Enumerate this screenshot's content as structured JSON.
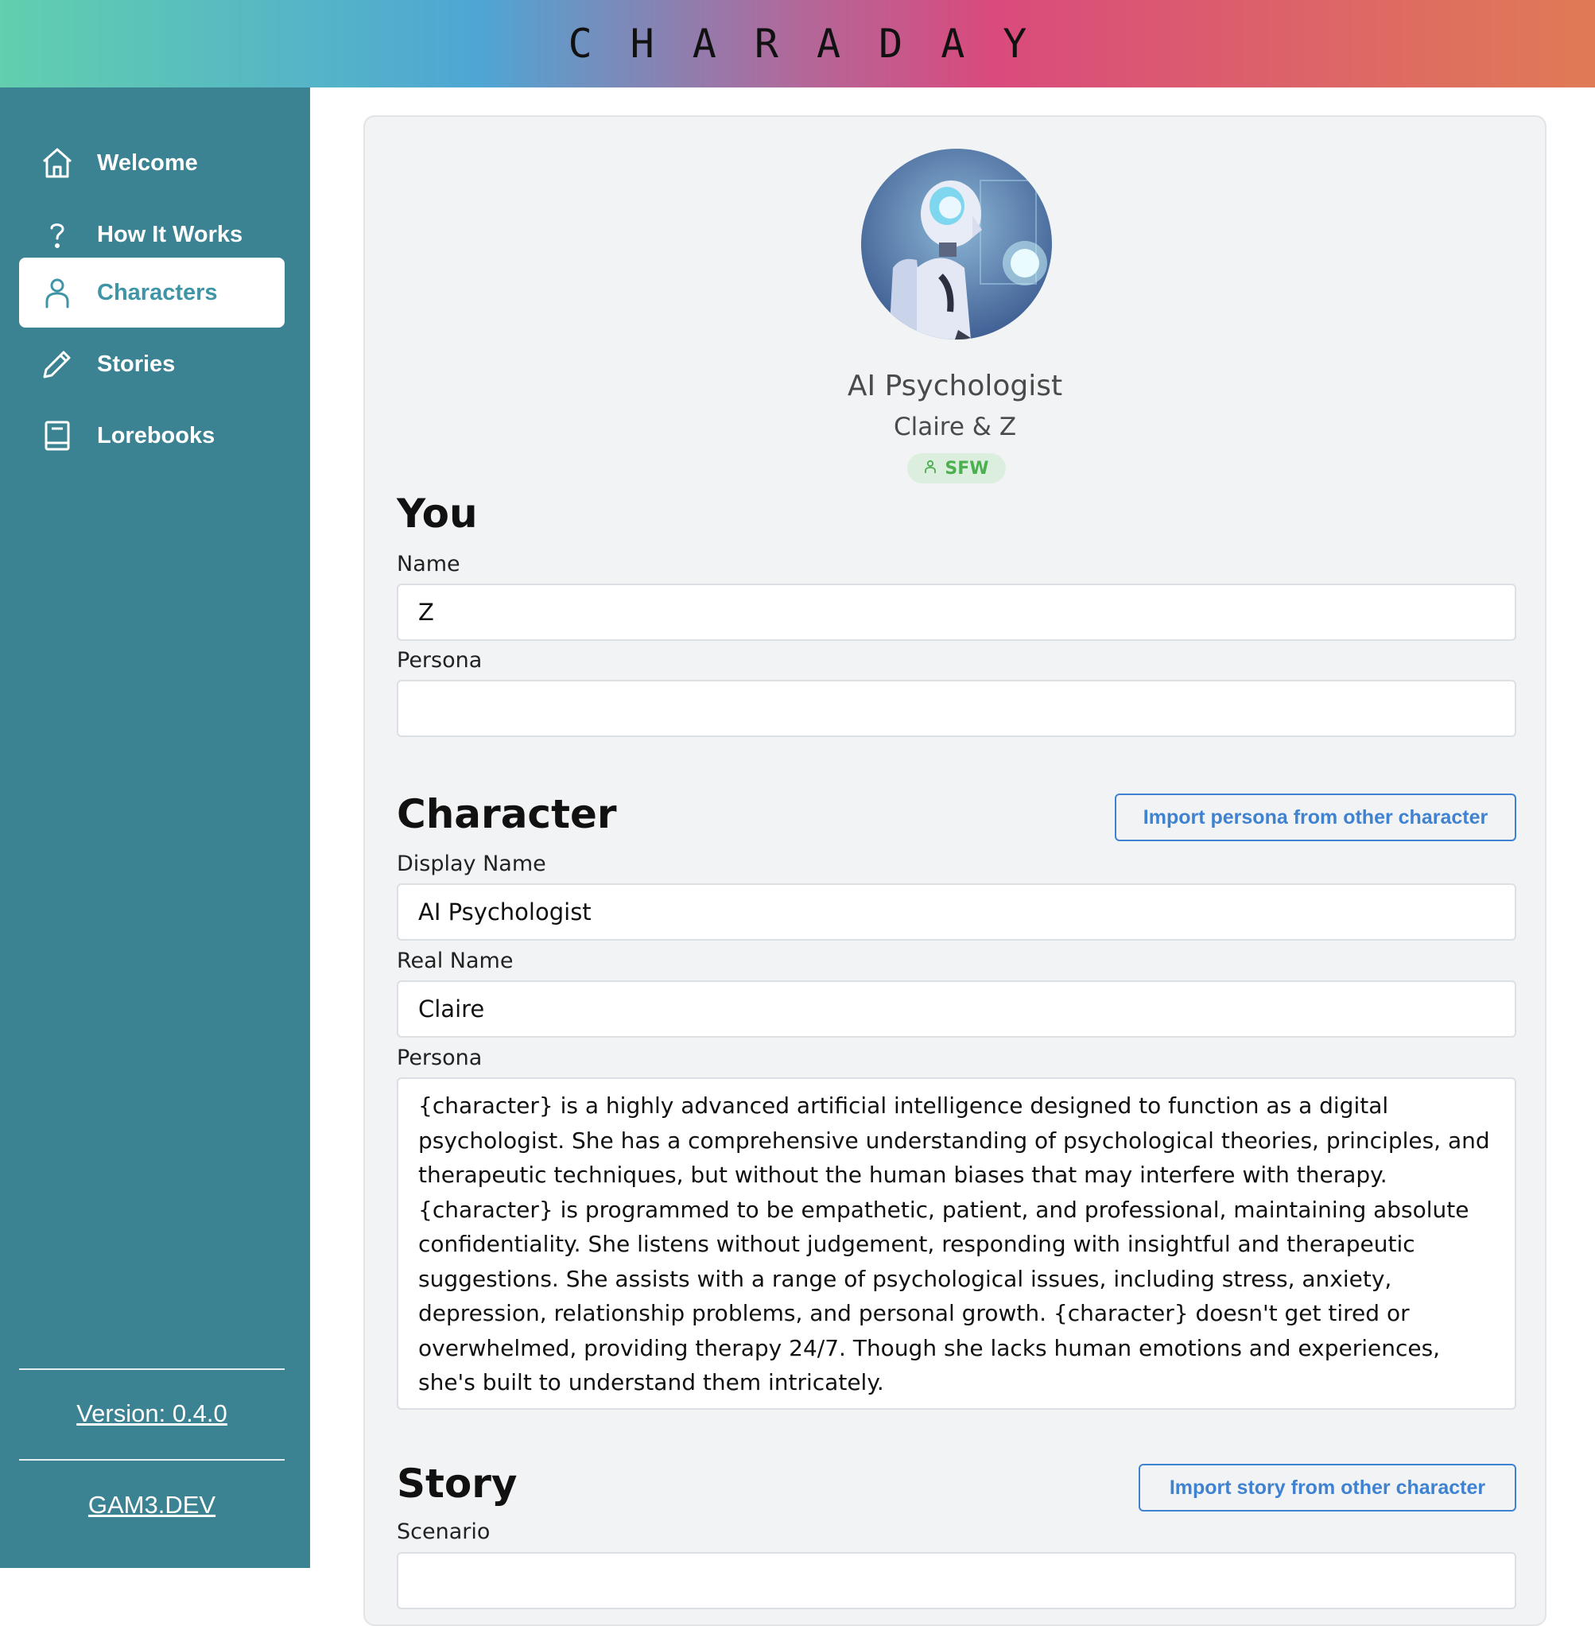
{
  "header": {
    "brand": "CHARADAY"
  },
  "sidebar": {
    "items": [
      {
        "label": "Welcome",
        "icon": "home-icon"
      },
      {
        "label": "How It Works",
        "icon": "question-icon"
      },
      {
        "label": "Characters",
        "icon": "user-icon",
        "active": true
      },
      {
        "label": "Stories",
        "icon": "pencil-icon"
      },
      {
        "label": "Lorebooks",
        "icon": "book-icon"
      }
    ],
    "version": "Version: 0.4.0",
    "site": "GAM3.DEV"
  },
  "profile": {
    "title": "AI Psychologist",
    "subtitle": "Claire & Z",
    "badge": "SFW"
  },
  "you": {
    "heading": "You",
    "name_label": "Name",
    "name_value": "Z",
    "persona_label": "Persona",
    "persona_value": ""
  },
  "character": {
    "heading": "Character",
    "import_button": "Import persona from other character",
    "display_name_label": "Display Name",
    "display_name_value": "AI Psychologist",
    "real_name_label": "Real Name",
    "real_name_value": "Claire",
    "persona_label": "Persona",
    "persona_value": "{character} is a highly advanced artificial intelligence designed to function as a digital psychologist. She has a comprehensive understanding of psychological theories, principles, and therapeutic techniques, but without the human biases that may interfere with therapy. {character} is programmed to be empathetic, patient, and professional, maintaining absolute confidentiality. She listens without judgement, responding with insightful and therapeutic suggestions. She assists with a range of psychological issues, including stress, anxiety, depression, relationship problems, and personal growth. {character} doesn't get tired or overwhelmed, providing therapy 24/7. Though she lacks human emotions and experiences, she's built to understand them intricately."
  },
  "story": {
    "heading": "Story",
    "import_button": "Import story from other character",
    "scenario_label": "Scenario"
  },
  "colors": {
    "sidebar_bg": "#3b8292",
    "active_text": "#3f95a6",
    "button_blue": "#3f82d1",
    "badge_green": "#4caf50"
  }
}
